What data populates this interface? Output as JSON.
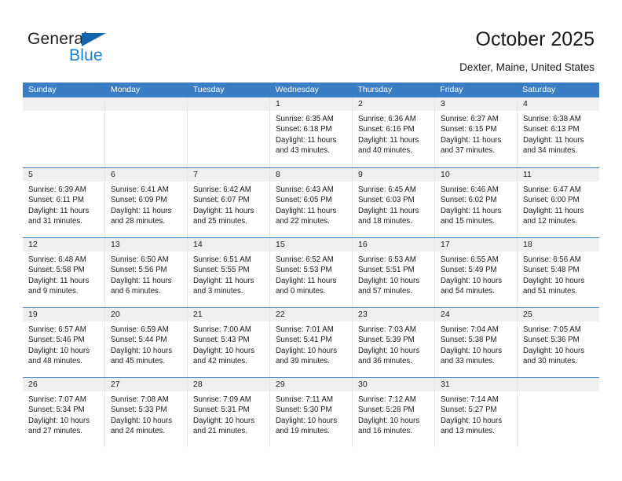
{
  "brand": {
    "name_part1": "General",
    "name_part2": "Blue",
    "triangle_icon": "triangle-icon",
    "color_dark": "#231f20",
    "color_blue": "#1a7fd4"
  },
  "header": {
    "title": "October 2025",
    "subtitle": "Dexter, Maine, United States"
  },
  "calendar": {
    "accent_color": "#3b7dc4",
    "daynum_bg": "#efefef",
    "weekdays": [
      "Sunday",
      "Monday",
      "Tuesday",
      "Wednesday",
      "Thursday",
      "Friday",
      "Saturday"
    ],
    "weeks": [
      [
        {
          "day": "",
          "lines": []
        },
        {
          "day": "",
          "lines": []
        },
        {
          "day": "",
          "lines": []
        },
        {
          "day": "1",
          "lines": [
            "Sunrise: 6:35 AM",
            "Sunset: 6:18 PM",
            "Daylight: 11 hours",
            "and 43 minutes."
          ]
        },
        {
          "day": "2",
          "lines": [
            "Sunrise: 6:36 AM",
            "Sunset: 6:16 PM",
            "Daylight: 11 hours",
            "and 40 minutes."
          ]
        },
        {
          "day": "3",
          "lines": [
            "Sunrise: 6:37 AM",
            "Sunset: 6:15 PM",
            "Daylight: 11 hours",
            "and 37 minutes."
          ]
        },
        {
          "day": "4",
          "lines": [
            "Sunrise: 6:38 AM",
            "Sunset: 6:13 PM",
            "Daylight: 11 hours",
            "and 34 minutes."
          ]
        }
      ],
      [
        {
          "day": "5",
          "lines": [
            "Sunrise: 6:39 AM",
            "Sunset: 6:11 PM",
            "Daylight: 11 hours",
            "and 31 minutes."
          ]
        },
        {
          "day": "6",
          "lines": [
            "Sunrise: 6:41 AM",
            "Sunset: 6:09 PM",
            "Daylight: 11 hours",
            "and 28 minutes."
          ]
        },
        {
          "day": "7",
          "lines": [
            "Sunrise: 6:42 AM",
            "Sunset: 6:07 PM",
            "Daylight: 11 hours",
            "and 25 minutes."
          ]
        },
        {
          "day": "8",
          "lines": [
            "Sunrise: 6:43 AM",
            "Sunset: 6:05 PM",
            "Daylight: 11 hours",
            "and 22 minutes."
          ]
        },
        {
          "day": "9",
          "lines": [
            "Sunrise: 6:45 AM",
            "Sunset: 6:03 PM",
            "Daylight: 11 hours",
            "and 18 minutes."
          ]
        },
        {
          "day": "10",
          "lines": [
            "Sunrise: 6:46 AM",
            "Sunset: 6:02 PM",
            "Daylight: 11 hours",
            "and 15 minutes."
          ]
        },
        {
          "day": "11",
          "lines": [
            "Sunrise: 6:47 AM",
            "Sunset: 6:00 PM",
            "Daylight: 11 hours",
            "and 12 minutes."
          ]
        }
      ],
      [
        {
          "day": "12",
          "lines": [
            "Sunrise: 6:48 AM",
            "Sunset: 5:58 PM",
            "Daylight: 11 hours",
            "and 9 minutes."
          ]
        },
        {
          "day": "13",
          "lines": [
            "Sunrise: 6:50 AM",
            "Sunset: 5:56 PM",
            "Daylight: 11 hours",
            "and 6 minutes."
          ]
        },
        {
          "day": "14",
          "lines": [
            "Sunrise: 6:51 AM",
            "Sunset: 5:55 PM",
            "Daylight: 11 hours",
            "and 3 minutes."
          ]
        },
        {
          "day": "15",
          "lines": [
            "Sunrise: 6:52 AM",
            "Sunset: 5:53 PM",
            "Daylight: 11 hours",
            "and 0 minutes."
          ]
        },
        {
          "day": "16",
          "lines": [
            "Sunrise: 6:53 AM",
            "Sunset: 5:51 PM",
            "Daylight: 10 hours",
            "and 57 minutes."
          ]
        },
        {
          "day": "17",
          "lines": [
            "Sunrise: 6:55 AM",
            "Sunset: 5:49 PM",
            "Daylight: 10 hours",
            "and 54 minutes."
          ]
        },
        {
          "day": "18",
          "lines": [
            "Sunrise: 6:56 AM",
            "Sunset: 5:48 PM",
            "Daylight: 10 hours",
            "and 51 minutes."
          ]
        }
      ],
      [
        {
          "day": "19",
          "lines": [
            "Sunrise: 6:57 AM",
            "Sunset: 5:46 PM",
            "Daylight: 10 hours",
            "and 48 minutes."
          ]
        },
        {
          "day": "20",
          "lines": [
            "Sunrise: 6:59 AM",
            "Sunset: 5:44 PM",
            "Daylight: 10 hours",
            "and 45 minutes."
          ]
        },
        {
          "day": "21",
          "lines": [
            "Sunrise: 7:00 AM",
            "Sunset: 5:43 PM",
            "Daylight: 10 hours",
            "and 42 minutes."
          ]
        },
        {
          "day": "22",
          "lines": [
            "Sunrise: 7:01 AM",
            "Sunset: 5:41 PM",
            "Daylight: 10 hours",
            "and 39 minutes."
          ]
        },
        {
          "day": "23",
          "lines": [
            "Sunrise: 7:03 AM",
            "Sunset: 5:39 PM",
            "Daylight: 10 hours",
            "and 36 minutes."
          ]
        },
        {
          "day": "24",
          "lines": [
            "Sunrise: 7:04 AM",
            "Sunset: 5:38 PM",
            "Daylight: 10 hours",
            "and 33 minutes."
          ]
        },
        {
          "day": "25",
          "lines": [
            "Sunrise: 7:05 AM",
            "Sunset: 5:36 PM",
            "Daylight: 10 hours",
            "and 30 minutes."
          ]
        }
      ],
      [
        {
          "day": "26",
          "lines": [
            "Sunrise: 7:07 AM",
            "Sunset: 5:34 PM",
            "Daylight: 10 hours",
            "and 27 minutes."
          ]
        },
        {
          "day": "27",
          "lines": [
            "Sunrise: 7:08 AM",
            "Sunset: 5:33 PM",
            "Daylight: 10 hours",
            "and 24 minutes."
          ]
        },
        {
          "day": "28",
          "lines": [
            "Sunrise: 7:09 AM",
            "Sunset: 5:31 PM",
            "Daylight: 10 hours",
            "and 21 minutes."
          ]
        },
        {
          "day": "29",
          "lines": [
            "Sunrise: 7:11 AM",
            "Sunset: 5:30 PM",
            "Daylight: 10 hours",
            "and 19 minutes."
          ]
        },
        {
          "day": "30",
          "lines": [
            "Sunrise: 7:12 AM",
            "Sunset: 5:28 PM",
            "Daylight: 10 hours",
            "and 16 minutes."
          ]
        },
        {
          "day": "31",
          "lines": [
            "Sunrise: 7:14 AM",
            "Sunset: 5:27 PM",
            "Daylight: 10 hours",
            "and 13 minutes."
          ]
        },
        {
          "day": "",
          "lines": []
        }
      ]
    ]
  }
}
